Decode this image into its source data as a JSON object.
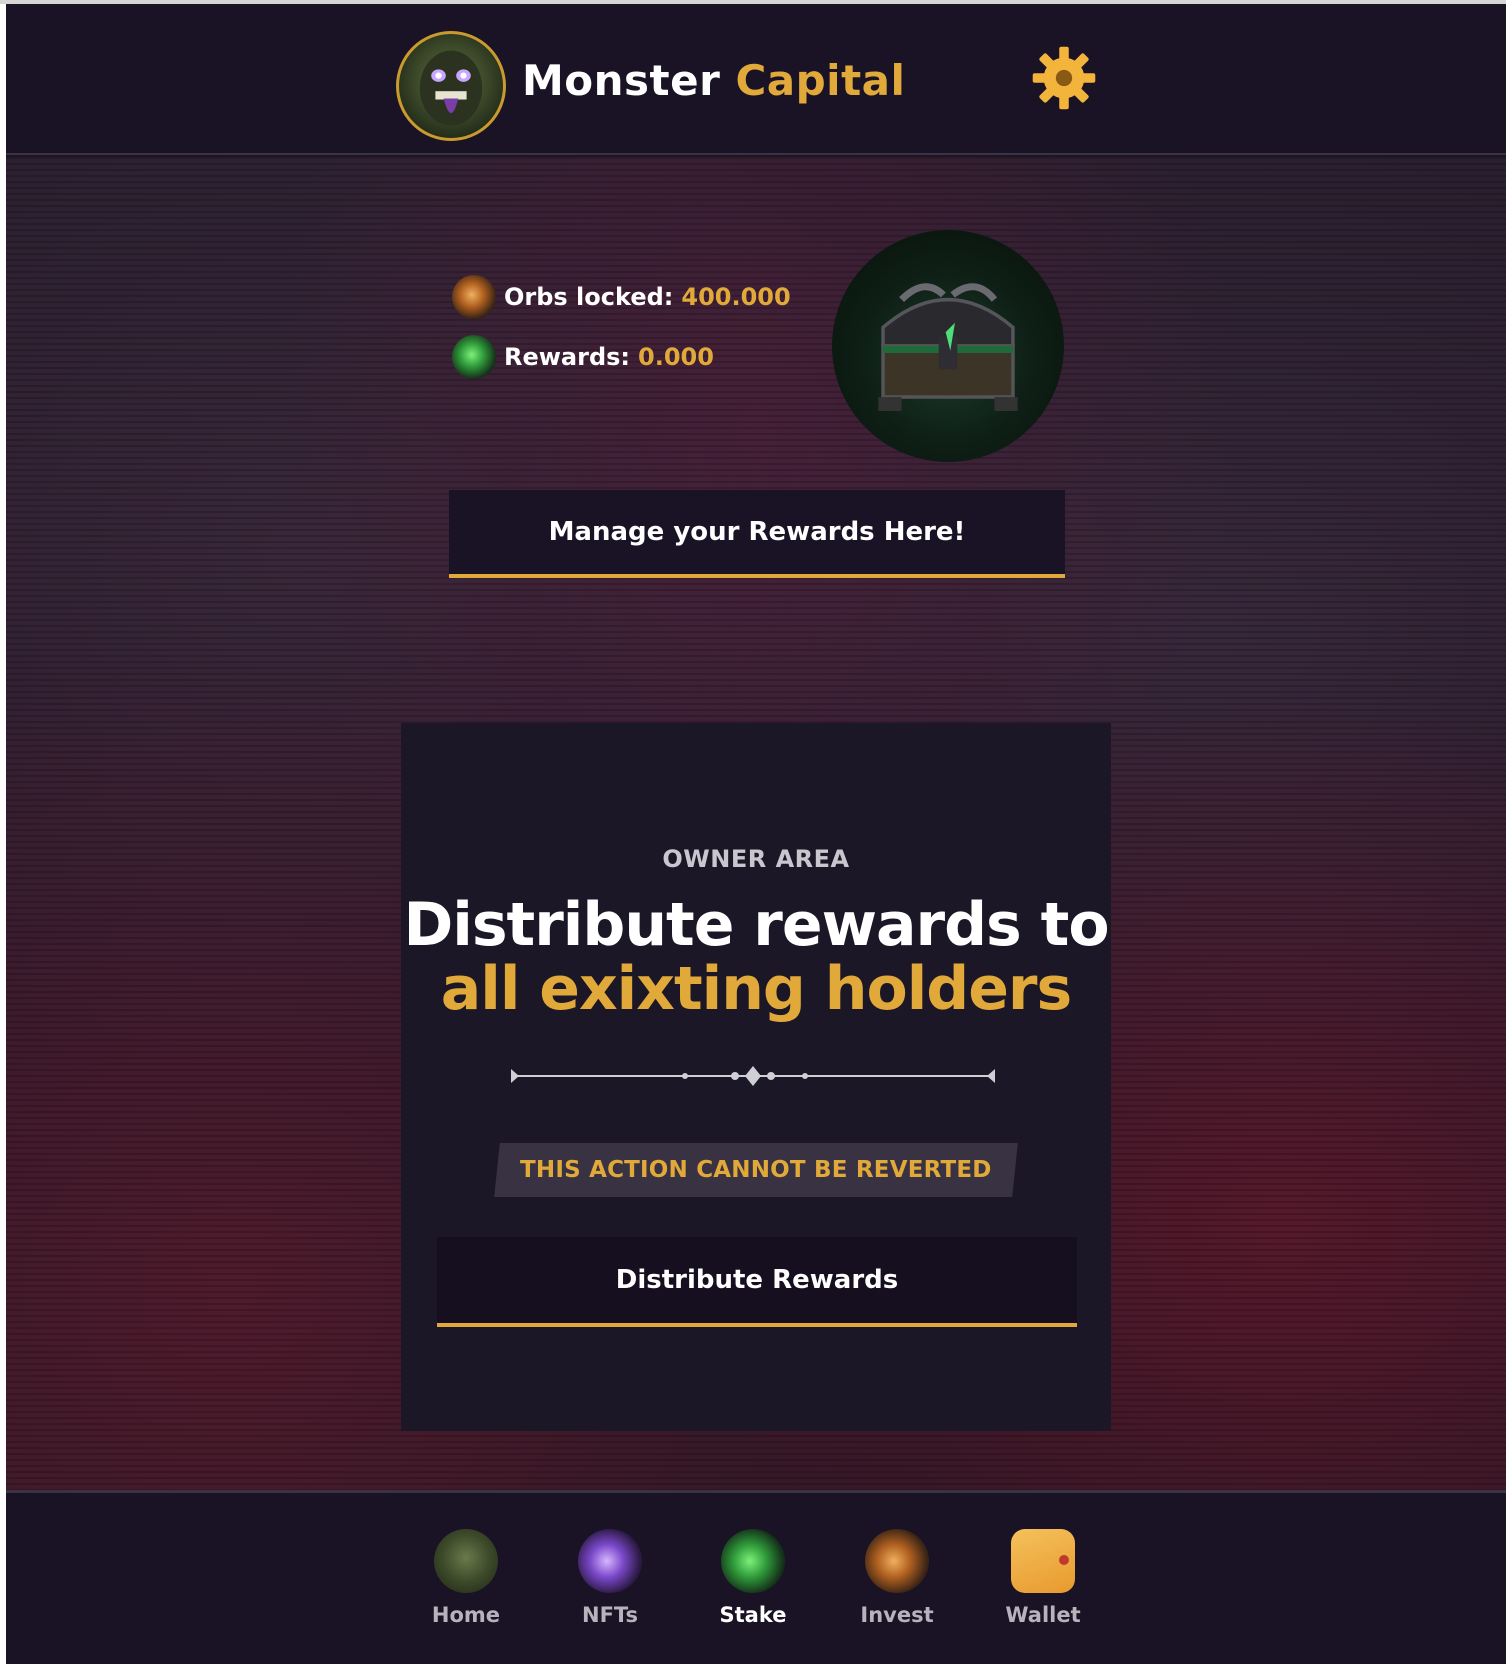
{
  "header": {
    "brand_first": "Monster",
    "brand_second": "Capital",
    "logo_icon": "monster-avatar-icon",
    "settings_icon": "gear-icon"
  },
  "stats": {
    "orbs_label": "Orbs locked:",
    "orbs_value": "400.000",
    "rewards_label": "Rewards:",
    "rewards_value": "0.000"
  },
  "manage_button_label": "Manage your Rewards Here!",
  "owner_area": {
    "label": "OWNER AREA",
    "title_line1": "Distribute rewards to",
    "title_line2": "all exixting holders",
    "warning": "THIS ACTION CANNOT BE REVERTED",
    "button_label": "Distribute Rewards"
  },
  "bottom_nav": {
    "items": [
      {
        "label": "Home",
        "icon": "home-monster-icon"
      },
      {
        "label": "NFTs",
        "icon": "nfts-orb-icon"
      },
      {
        "label": "Stake",
        "icon": "stake-orb-icon",
        "active": true
      },
      {
        "label": "Invest",
        "icon": "invest-orb-icon"
      },
      {
        "label": "Wallet",
        "icon": "wallet-icon"
      }
    ]
  },
  "colors": {
    "accent": "#e1a93a",
    "header_bg": "#1a1325",
    "card_bg": "#1c1726"
  }
}
